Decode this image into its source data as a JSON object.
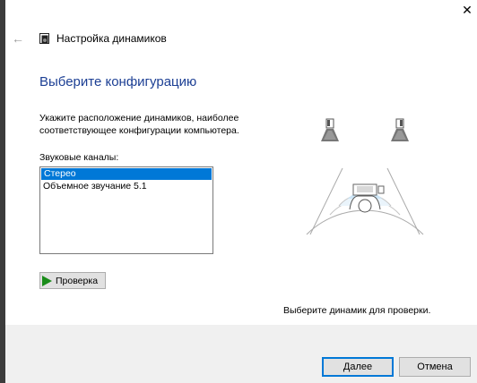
{
  "window": {
    "title": "Настройка динамиков",
    "close_glyph": "✕",
    "back_glyph": "←"
  },
  "main": {
    "heading": "Выберите конфигурацию",
    "instruction": "Укажите расположение динамиков, наиболее соответствующее конфигурации компьютера.",
    "channels_label": "Звуковые каналы:",
    "channels": [
      {
        "label": "Стерео",
        "selected": true
      },
      {
        "label": "Объемное звучание 5.1",
        "selected": false
      }
    ],
    "test_button": "Проверка",
    "hint": "Выберите динамик для проверки."
  },
  "footer": {
    "next_button": "Далее",
    "cancel_button": "Отмена"
  },
  "colors": {
    "heading": "#1c3f94",
    "selection": "#0078d7",
    "play": "#1a8c1a",
    "sound_wave": "#cde6f7"
  },
  "icons": [
    "back-arrow-icon",
    "speaker-settings-icon",
    "play-icon",
    "close-icon",
    "speaker-icon",
    "listener-icon"
  ]
}
